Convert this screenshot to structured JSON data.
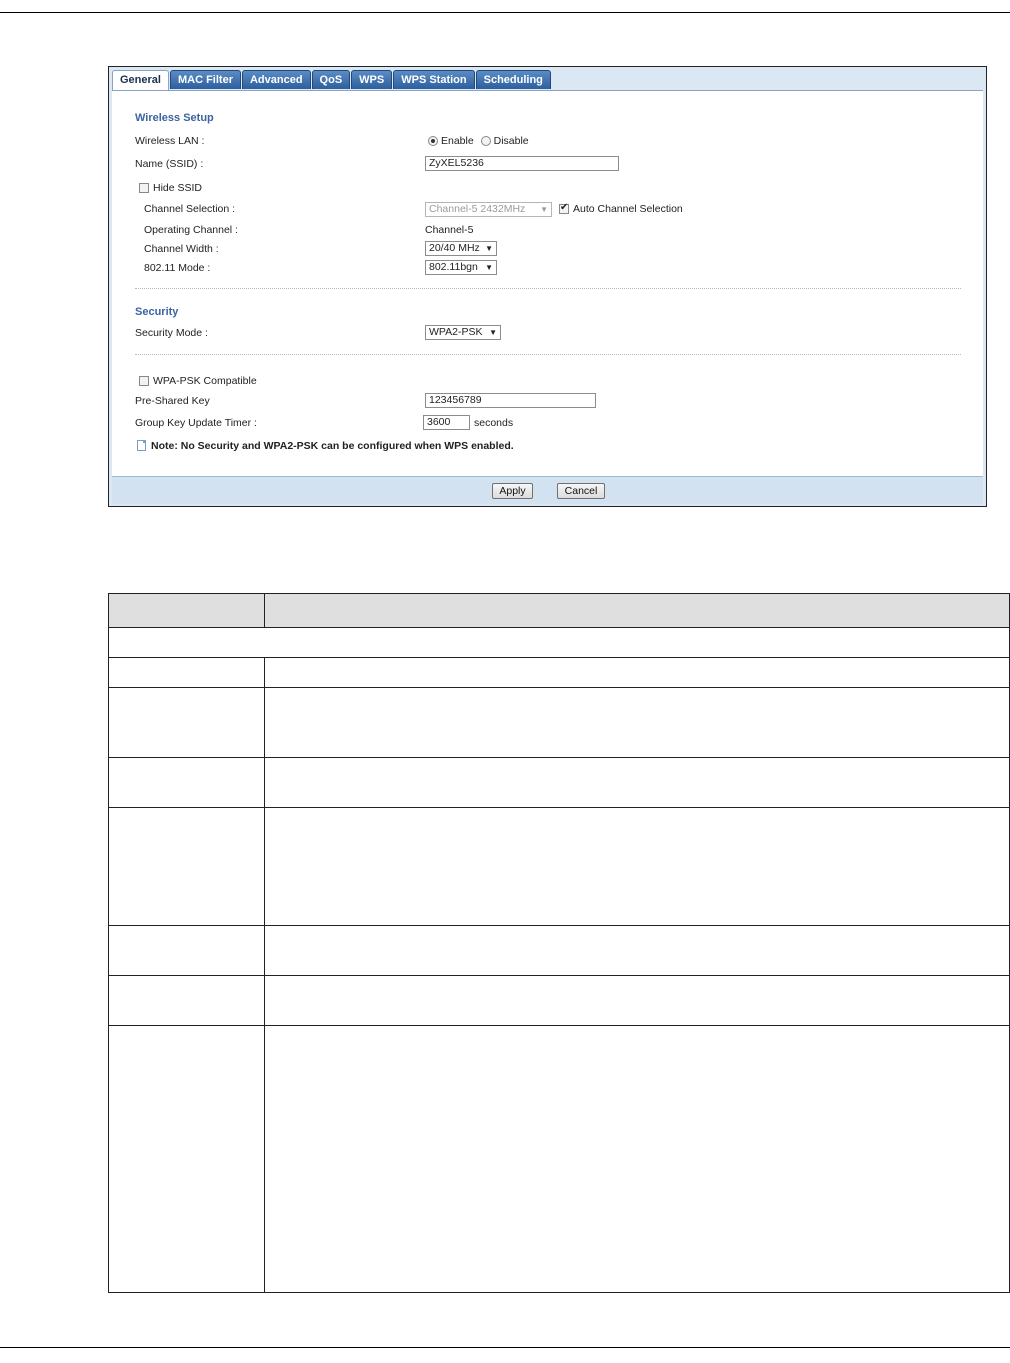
{
  "tabs": [
    {
      "label": "General",
      "active": true
    },
    {
      "label": "MAC Filter",
      "active": false
    },
    {
      "label": "Advanced",
      "active": false
    },
    {
      "label": "QoS",
      "active": false
    },
    {
      "label": "WPS",
      "active": false
    },
    {
      "label": "WPS Station",
      "active": false
    },
    {
      "label": "Scheduling",
      "active": false
    }
  ],
  "wireless_setup": {
    "title": "Wireless Setup",
    "wireless_lan_label": "Wireless LAN :",
    "enable_label": "Enable",
    "disable_label": "Disable",
    "wireless_lan_value": "Enable",
    "name_label": "Name (SSID) :",
    "ssid_value": "ZyXEL5236",
    "hide_ssid_label": "Hide SSID",
    "hide_ssid_checked": false,
    "channel_selection_label": "Channel Selection :",
    "channel_selection_value": "Channel-5 2432MHz",
    "auto_channel_label": "Auto Channel Selection",
    "auto_channel_checked": true,
    "operating_channel_label": "Operating Channel :",
    "operating_channel_value": "Channel-5",
    "channel_width_label": "Channel Width :",
    "channel_width_value": "20/40 MHz",
    "mode_label": "802.11 Mode :",
    "mode_value": "802.11bgn"
  },
  "security": {
    "title": "Security",
    "mode_label": "Security Mode :",
    "mode_value": "WPA2-PSK",
    "wpa_psk_compatible_label": "WPA-PSK Compatible",
    "wpa_psk_compatible_checked": false,
    "psk_label": "Pre-Shared Key",
    "psk_value": "123456789",
    "group_key_label": "Group Key Update Timer :",
    "group_key_value": "3600",
    "seconds_label": "seconds",
    "note": "Note: No Security and WPA2-PSK can be configured when WPS enabled."
  },
  "buttons": {
    "apply": "Apply",
    "cancel": "Cancel"
  },
  "colors": {
    "tab_blue": "#2c5f9e",
    "section_title": "#3b64a0",
    "footer_bar": "#d3e2f1"
  }
}
